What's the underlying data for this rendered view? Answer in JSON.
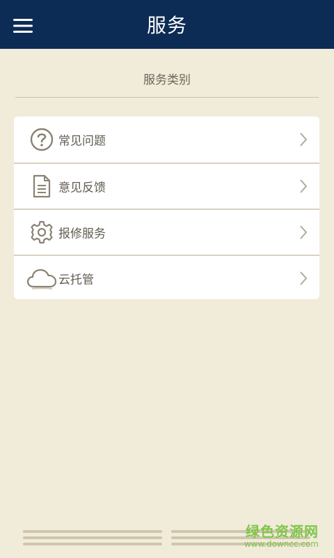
{
  "header": {
    "title": "服务",
    "menu_icon": "hamburger-menu-icon",
    "background": "#0c2b55"
  },
  "section": {
    "title": "服务类别"
  },
  "list": {
    "items": [
      {
        "label": "常见问题",
        "icon": "question-circle-icon"
      },
      {
        "label": "意见反馈",
        "icon": "document-icon"
      },
      {
        "label": "报修服务",
        "icon": "gear-icon"
      },
      {
        "label": "云托管",
        "icon": "cloud-icon"
      }
    ]
  },
  "watermark": {
    "main": "绿色资源网",
    "sub": "www.downcc.com",
    "color": "#7fc54b"
  },
  "colors": {
    "page_background": "#f1ebda",
    "icon": "#8a8272"
  }
}
